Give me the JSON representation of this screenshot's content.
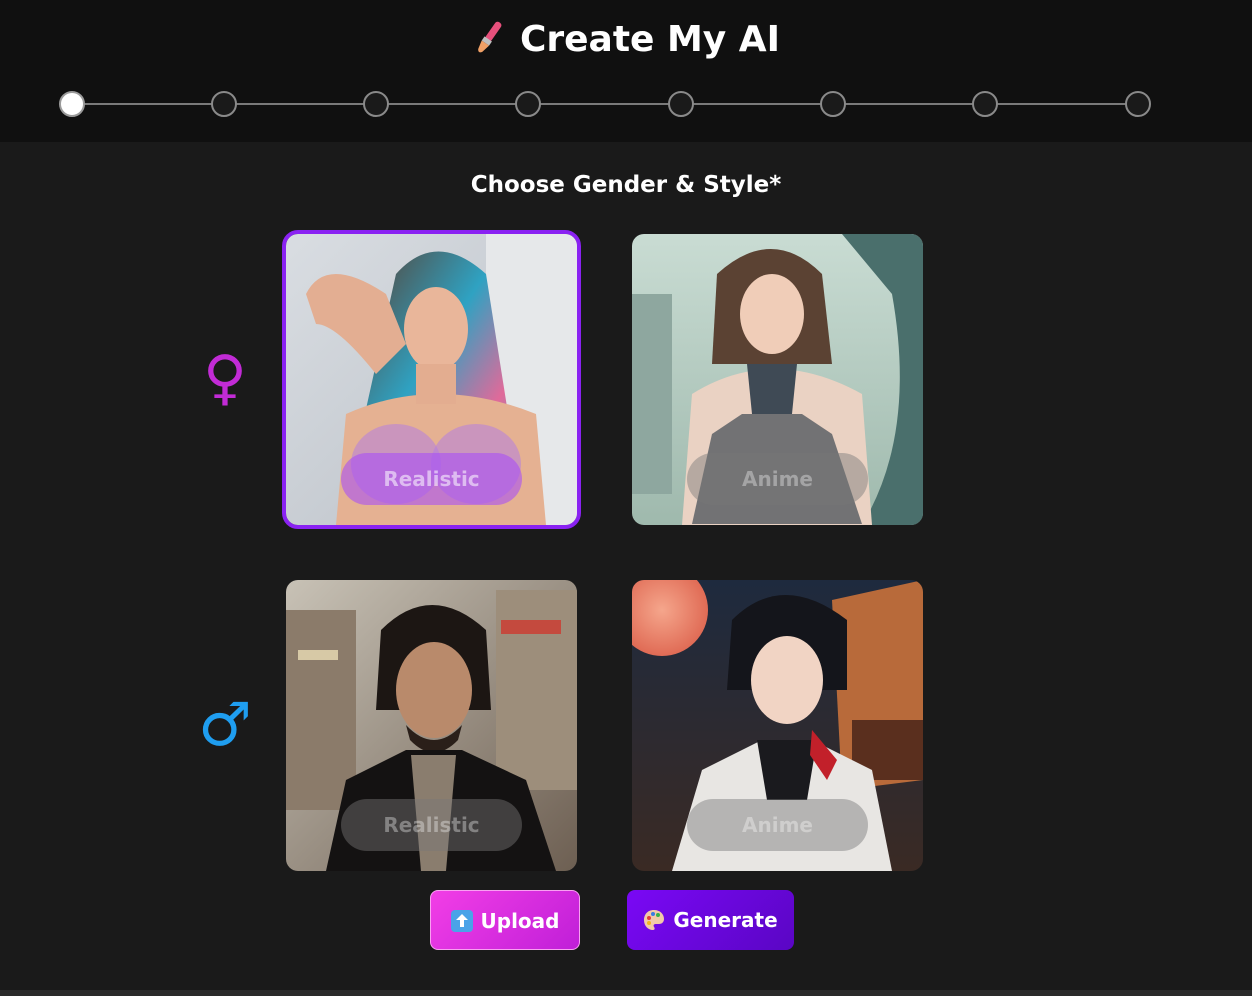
{
  "header": {
    "title": "Create My AI",
    "title_icon": "paintbrush-icon"
  },
  "stepper": {
    "total_steps": 8,
    "current_step": 1
  },
  "section": {
    "title": "Choose Gender & Style*"
  },
  "genders": [
    {
      "symbol": "♀",
      "color": "#c22bd6",
      "options": [
        {
          "label": "Realistic",
          "selected": true
        },
        {
          "label": "Anime",
          "selected": false
        }
      ]
    },
    {
      "symbol": "♂",
      "color": "#1f9ef0",
      "options": [
        {
          "label": "Realistic",
          "selected": false
        },
        {
          "label": "Anime",
          "selected": false
        }
      ]
    }
  ],
  "actions": {
    "upload_label": "Upload",
    "upload_icon": "upload-arrow-icon",
    "generate_label": "Generate",
    "generate_icon": "palette-icon"
  },
  "colors": {
    "accent_purple": "#8a22f2",
    "upload_pink": "#e536e0",
    "generate_violet": "#7a08f5"
  }
}
